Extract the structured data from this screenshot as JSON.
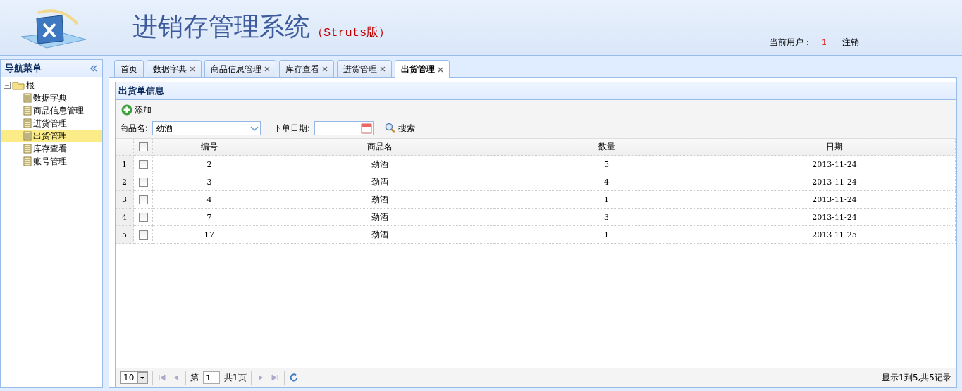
{
  "header": {
    "title": "进销存管理系统",
    "subtitle": "（Struts版）",
    "user_label": "当前用户：",
    "user_name": "1",
    "logout": "注销"
  },
  "nav": {
    "title": "导航菜单",
    "tree": [
      {
        "label": "根",
        "expanded": true,
        "children": [
          {
            "label": "数据字典",
            "selected": false
          },
          {
            "label": "商品信息管理",
            "selected": false
          },
          {
            "label": "进货管理",
            "selected": false
          },
          {
            "label": "出货管理",
            "selected": true
          },
          {
            "label": "库存查看",
            "selected": false
          },
          {
            "label": "账号管理",
            "selected": false
          }
        ]
      }
    ]
  },
  "tabs": [
    {
      "label": "首页",
      "closable": false,
      "selected": false
    },
    {
      "label": "数据字典",
      "closable": true,
      "selected": false
    },
    {
      "label": "商品信息管理",
      "closable": true,
      "selected": false
    },
    {
      "label": "库存查看",
      "closable": true,
      "selected": false
    },
    {
      "label": "进货管理",
      "closable": true,
      "selected": false
    },
    {
      "label": "出货管理",
      "closable": true,
      "selected": true
    }
  ],
  "panel": {
    "title": "出货单信息",
    "add_button": "添加",
    "search": {
      "product_label": "商品名:",
      "product_value": "劲酒",
      "date_label": "下单日期:",
      "search_button": "搜索"
    },
    "table": {
      "header_checked": false,
      "columns": [
        "编号",
        "商品名",
        "数量",
        "日期"
      ],
      "rows": [
        {
          "row_number": "1",
          "checked": false,
          "cells": [
            "2",
            "劲酒",
            "5",
            "2013-11-24"
          ]
        },
        {
          "row_number": "2",
          "checked": false,
          "cells": [
            "3",
            "劲酒",
            "4",
            "2013-11-24"
          ]
        },
        {
          "row_number": "3",
          "checked": false,
          "cells": [
            "4",
            "劲酒",
            "1",
            "2013-11-24"
          ]
        },
        {
          "row_number": "4",
          "checked": false,
          "cells": [
            "7",
            "劲酒",
            "3",
            "2013-11-24"
          ]
        },
        {
          "row_number": "5",
          "checked": false,
          "cells": [
            "17",
            "劲酒",
            "1",
            "2013-11-25"
          ]
        }
      ]
    },
    "pager": {
      "page_size": "10",
      "page_label": "第",
      "page": "1",
      "total": "共1页",
      "summary": "显示1到5,共5记录"
    }
  }
}
